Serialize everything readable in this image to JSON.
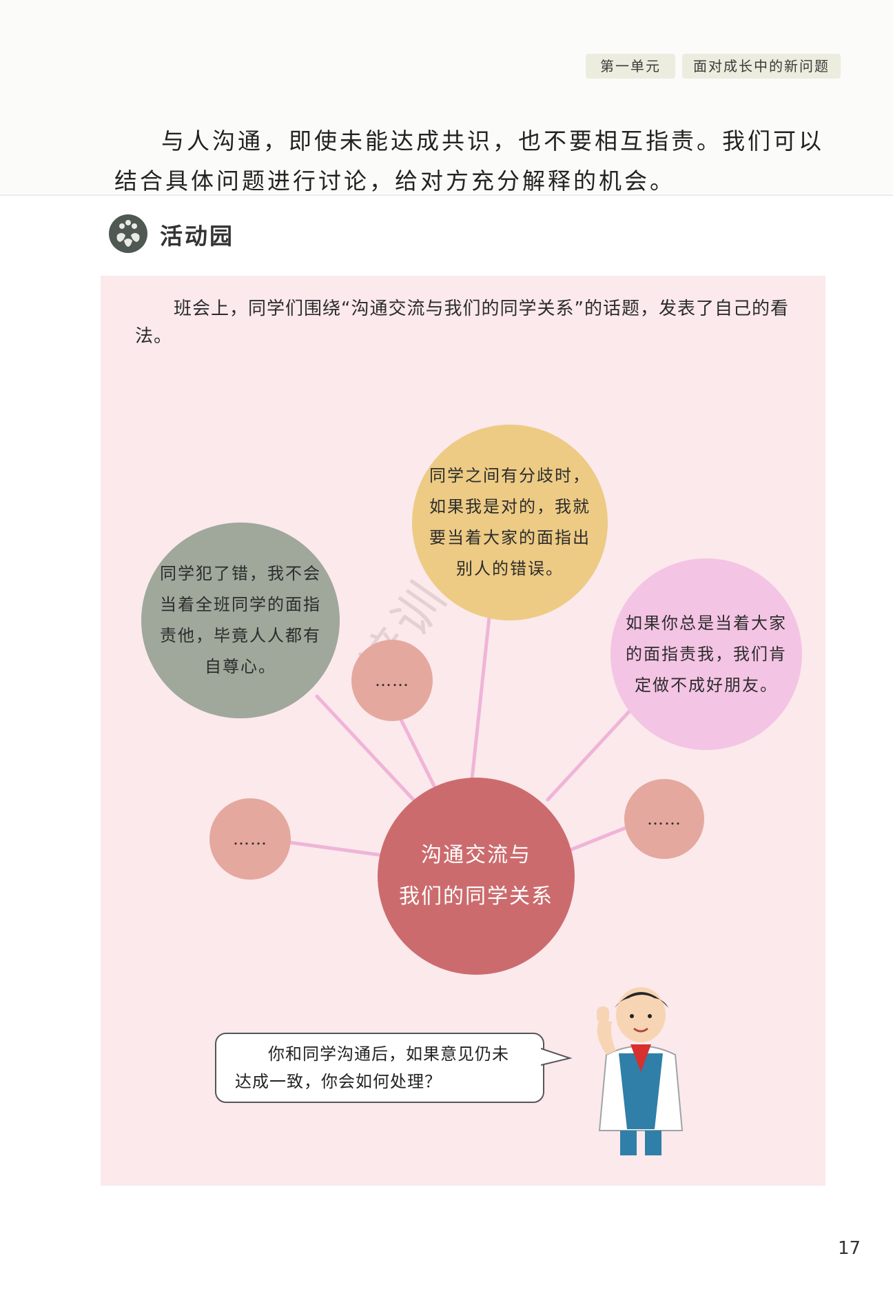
{
  "header": {
    "unit": "第一单元",
    "chapter": "面对成长中的新问题"
  },
  "intro_text": "与人沟通，即使未能达成共识，也不要相互指责。我们可以结合具体问题进行讨论，给对方充分解释的机会。",
  "section": {
    "icon": "hands-circle-icon",
    "title": "活动园"
  },
  "activity": {
    "text": "班会上，同学们围绕“沟通交流与我们的同学关系”的话题，发表了自己的看法。",
    "center_topic_line1": "沟通交流与",
    "center_topic_line2": "我们的同学关系",
    "opinions": [
      "同学犯了错，我不会当着全班同学的面指责他，毕竟人人都有自尊心。",
      "同学之间有分歧时，如果我是对的，我就要当着大家的面指出别人的错误。",
      "如果你总是当着大家的面指责我，我们肯定做不成好朋友。"
    ],
    "ellipsis": "……",
    "question": "你和同学沟通后，如果意见仍未达成一致，你会如何处理？"
  },
  "watermark": "培训用书",
  "page_number": "17",
  "colors": {
    "panel_background": "#fbe9ec",
    "green_bubble": "#9fa89b",
    "yellow_bubble": "#edcb84",
    "pink_bubble": "#f4c4e4",
    "small_bubble": "#e5a89e",
    "center_bubble": "#cc6b6d"
  }
}
